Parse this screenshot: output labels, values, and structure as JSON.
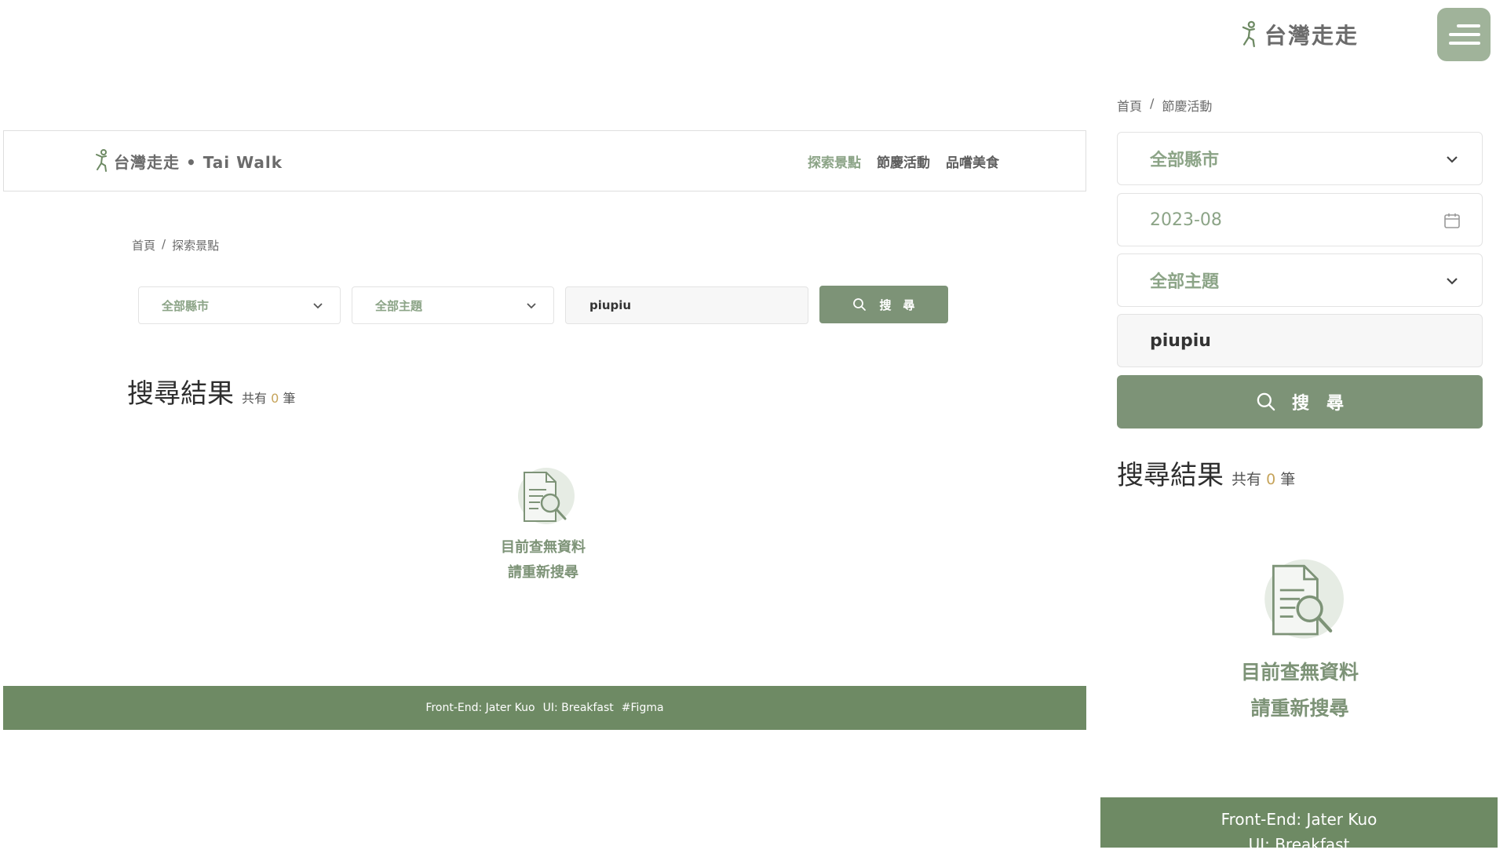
{
  "desktop": {
    "logo_text": "台灣走走 • Tai Walk",
    "nav": [
      {
        "label": "探索景點"
      },
      {
        "label": "節慶活動"
      },
      {
        "label": "品嚐美食"
      }
    ],
    "breadcrumb": {
      "home": "首頁",
      "sep": "/",
      "current": "探索景點"
    },
    "filters": {
      "city": "全部縣市",
      "theme": "全部主題",
      "keyword": "piupiu"
    },
    "search_label": "搜　尋",
    "results": {
      "title": "搜尋結果",
      "prefix": "共有",
      "count": "0",
      "suffix": "筆"
    },
    "empty": {
      "line1": "目前查無資料",
      "line2": "請重新搜尋"
    },
    "footer": {
      "frontend": "Front-End: Jater Kuo",
      "ui": "UI: Breakfast",
      "tag": "#Figma"
    }
  },
  "mobile": {
    "logo_text": "台灣走走",
    "breadcrumb": {
      "home": "首頁",
      "sep": "/",
      "current": "節慶活動"
    },
    "filters": {
      "city": "全部縣市",
      "date": "2023-08",
      "theme": "全部主題",
      "keyword": "piupiu"
    },
    "search_label": "搜　尋",
    "results": {
      "title": "搜尋結果",
      "prefix": "共有",
      "count": "0",
      "suffix": "筆"
    },
    "empty": {
      "line1": "目前查無資料",
      "line2": "請重新搜尋"
    },
    "footer": {
      "frontend": "Front-End: Jater Kuo",
      "ui": "UI: Breakfast"
    }
  },
  "colors": {
    "primary": "#7d9377",
    "footer": "#6e8a64",
    "accent_text": "#8ca487",
    "count": "#c6a45b",
    "menu_button": "#a0b39a"
  },
  "icons": [
    "walker-logo-icon",
    "chevron-down-icon",
    "search-icon",
    "calendar-icon",
    "menu-icon",
    "document-search-icon"
  ]
}
